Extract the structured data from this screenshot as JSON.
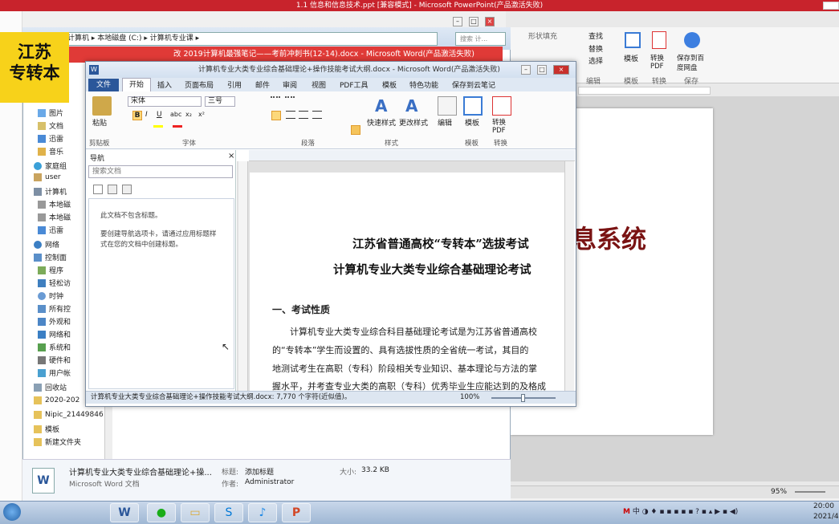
{
  "ppt": {
    "title": "1.1 信息和信息技术.ppt [兼容模式] - Microsoft PowerPoint(产品激活失败)",
    "ribbon": {
      "find": "查找",
      "replace": "替换",
      "select": "选择",
      "edit_group": "编辑",
      "template": "模板",
      "template_group": "模板",
      "to_pdf": "转换PDF",
      "convert_group": "转换",
      "save_baidu": "保存到百度网盘",
      "save_group": "保存",
      "shape_fill": "形状填充"
    },
    "slide_text": "息系统",
    "zoom": "95%",
    "clock_time": "20:00",
    "clock_date": "2021/4"
  },
  "logo": {
    "line1": "江苏",
    "line2": "专转本"
  },
  "explorer": {
    "breadcrumb": [
      "计算机",
      "本地磁盘 (C:)",
      "计算机专业课"
    ],
    "search_placeholder": "搜索 计...",
    "nav": [
      "图片",
      "文档",
      "迅雷",
      "音乐",
      "家庭组",
      "user",
      "计算机",
      "本地磁",
      "本地磁",
      "迅雷",
      "网络",
      "控制面",
      "程序",
      "轻松访",
      "时钟",
      "所有控",
      "外观和",
      "网络和",
      "系统和",
      "硬件和",
      "用户帐",
      "回收站",
      "2020-202",
      "Nipic_21449846",
      "模板",
      "新建文件夹"
    ],
    "details": {
      "name": "计算机专业大类专业综合基础理论+操...",
      "type": "Microsoft Word 文档",
      "title_label": "标题:",
      "title_value": "添加标题",
      "author_label": "作者:",
      "author_value": "Administrator",
      "size_label": "大小:",
      "size_value": "33.2 KB"
    }
  },
  "word2": {
    "title": "改 2019计算机最强笔记——考前冲刺书(12-14).docx - Microsoft Word(产品激活失败)"
  },
  "word": {
    "title": "计算机专业大类专业综合基础理论+操作技能考试大纲.docx - Microsoft Word(产品激活失败)",
    "tabs": [
      "文件",
      "开始",
      "插入",
      "页面布局",
      "引用",
      "邮件",
      "审阅",
      "视图",
      "PDF工具",
      "模板",
      "特色功能",
      "保存到云笔记"
    ],
    "ribbon": {
      "paste": "粘贴",
      "clipboard": "剪贴板",
      "font_name": "宋体",
      "font_size": "三号",
      "font_group": "字体",
      "paragraph_group": "段落",
      "quick_styles": "快速样式",
      "change_styles": "更改样式",
      "styles_group": "样式",
      "edit": "编辑",
      "template": "模板",
      "template_group": "模板",
      "to_pdf": "转换PDF",
      "convert_group": "转换"
    },
    "nav": {
      "title": "导航",
      "search": "搜索文档",
      "empty1": "此文档不包含标题。",
      "empty2": "要创建导航选项卡，请通过应用标题样式在您的文档中创建标题。"
    },
    "doc": {
      "heading1": "江苏省普通高校“专转本”选拔考试",
      "heading2": "计算机专业大类专业综合基础理论考试",
      "section": "一、考试性质",
      "p1": "计算机专业大类专业综合科目基础理论考试是为江苏省普通高校",
      "p2": "的“专转本”学生而设置的、具有选拔性质的全省统一考试，其目的",
      "p3": "地测试考生在高职（专科）阶段相关专业知识、基本理论与方法的掌",
      "p4": "握水平，并考查专业大类的高职（专科）优秀毕业生应能达到的及格成"
    },
    "status": "计算机专业大类专业综合基础理论+操作技能考试大纲.docx: 7,770 个字符(近似值)。",
    "zoom": "100%"
  }
}
